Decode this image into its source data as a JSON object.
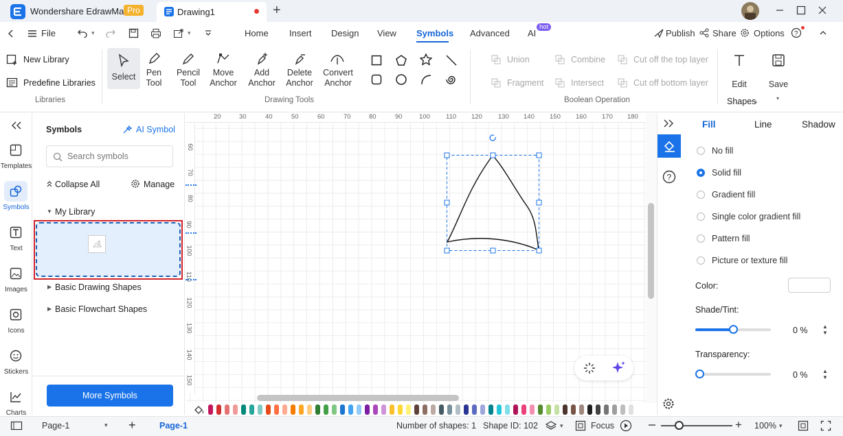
{
  "app": {
    "name": "Wondershare EdrawMax",
    "badge": "Pro",
    "doc_tab": "Drawing1"
  },
  "menubar": {
    "file": "File",
    "tabs": [
      "Home",
      "Insert",
      "Design",
      "View",
      "Symbols",
      "Advanced",
      "AI"
    ],
    "active_tab": "Symbols",
    "ai_badge": "hot",
    "publish": "Publish",
    "share": "Share",
    "options": "Options"
  },
  "ribbon": {
    "libraries": {
      "new_library": "New Library",
      "predefine": "Predefine Libraries",
      "group": "Libraries"
    },
    "drawing_tools": {
      "select": "Select",
      "pen": [
        "Pen",
        "Tool"
      ],
      "pencil": [
        "Pencil",
        "Tool"
      ],
      "move_anchor": [
        "Move",
        "Anchor"
      ],
      "add_anchor": [
        "Add",
        "Anchor"
      ],
      "delete_anchor": [
        "Delete",
        "Anchor"
      ],
      "convert_anchor": [
        "Convert",
        "Anchor"
      ],
      "group": "Drawing Tools"
    },
    "boolean": {
      "union": "Union",
      "combine": "Combine",
      "cut_top": "Cut off the top layer",
      "fragment": "Fragment",
      "intersect": "Intersect",
      "cut_bottom": "Cut off bottom layer",
      "group": "Boolean Operation"
    },
    "edit": "Edit",
    "save": "Save",
    "shapes": "Shapes"
  },
  "left_rail": [
    "Templates",
    "Symbols",
    "Text",
    "Images",
    "Icons",
    "Stickers",
    "Charts"
  ],
  "symbols_panel": {
    "title": "Symbols",
    "ai_symbol": "AI Symbol",
    "search_placeholder": "Search symbols",
    "collapse_all": "Collapse All",
    "manage": "Manage",
    "my_library": "My Library",
    "libs": [
      "Basic Drawing Shapes",
      "Basic Flowchart Shapes"
    ],
    "more_symbols": "More Symbols"
  },
  "ruler": {
    "h": [
      "20",
      "30",
      "40",
      "50",
      "60",
      "70",
      "80",
      "90",
      "100",
      "110",
      "120",
      "130",
      "140",
      "150",
      "160",
      "170",
      "180"
    ],
    "v": [
      "60",
      "70",
      "80",
      "90",
      "100",
      "110",
      "120",
      "130",
      "140",
      "150"
    ]
  },
  "right_panel": {
    "tabs": [
      "Fill",
      "Line",
      "Shadow"
    ],
    "fill_options": [
      "No fill",
      "Solid fill",
      "Gradient fill",
      "Single color gradient fill",
      "Pattern fill",
      "Picture or texture fill"
    ],
    "selected_fill": "Solid fill",
    "color_label": "Color:",
    "shade_label": "Shade/Tint:",
    "shade_value": "0 %",
    "shade_level": 0.5,
    "transparency_label": "Transparency:",
    "transparency_value": "0 %",
    "transparency_level": 0
  },
  "status": {
    "page_select": "Page-1",
    "page_tab": "Page-1",
    "num_shapes": "Number of shapes: 1",
    "shape_id": "Shape ID: 102",
    "focus": "Focus",
    "zoom": "100%"
  },
  "colors": {
    "accent": "#1a73e8",
    "active_tab": "#1565d8",
    "highlight_box": "#d0222a"
  },
  "palette": [
    "#c2185b",
    "#d32f2f",
    "#e57373",
    "#ef9a9a",
    "#00897b",
    "#26a69a",
    "#80cbc4",
    "#e64a19",
    "#ff7043",
    "#ffab91",
    "#f57c00",
    "#ffa726",
    "#ffcc80",
    "#2e7d32",
    "#43a047",
    "#81c784",
    "#1976d2",
    "#42a5f5",
    "#90caf9",
    "#7b1fa2",
    "#ab47bc",
    "#ce93d8",
    "#fbc02d",
    "#fdd835",
    "#fff176",
    "#5d4037",
    "#8d6e63",
    "#bcaaa4",
    "#455a64",
    "#78909c",
    "#b0bec5",
    "#283593",
    "#5c6bc0",
    "#9fa8da",
    "#00838f",
    "#26c6da",
    "#80deea",
    "#ad1457",
    "#ec407a",
    "#f48fb1",
    "#558b2f",
    "#9ccc65",
    "#c5e1a5",
    "#4e342e",
    "#795548",
    "#a1887f",
    "#212121",
    "#424242",
    "#757575",
    "#9e9e9e",
    "#bdbdbd",
    "#e0e0e0"
  ]
}
